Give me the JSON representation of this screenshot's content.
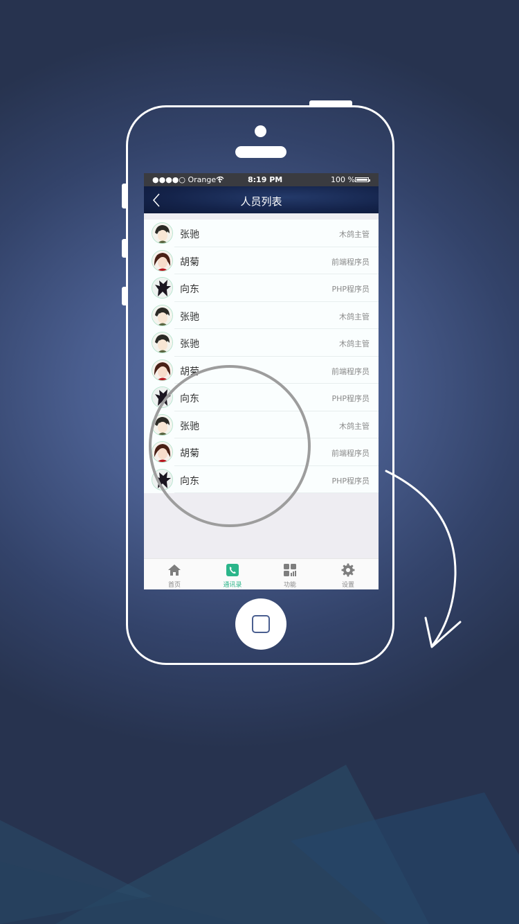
{
  "status_bar": {
    "carrier": "●●●●○ Orange F",
    "time": "8:19 PM",
    "battery": "100 %"
  },
  "nav": {
    "title": "人员列表",
    "back_icon": "chevron-left-icon"
  },
  "contacts": [
    {
      "name": "张驰",
      "role": "木鸽主管",
      "avatar": "boy"
    },
    {
      "name": "胡菊",
      "role": "前端程序员",
      "avatar": "girl"
    },
    {
      "name": "向东",
      "role": "PHP程序员",
      "avatar": "dark"
    },
    {
      "name": "张驰",
      "role": "木鸽主管",
      "avatar": "boy"
    },
    {
      "name": "张驰",
      "role": "木鸽主管",
      "avatar": "boy"
    },
    {
      "name": "胡菊",
      "role": "前端程序员",
      "avatar": "girl"
    },
    {
      "name": "向东",
      "role": "PHP程序员",
      "avatar": "dark"
    },
    {
      "name": "张驰",
      "role": "木鸽主管",
      "avatar": "boy"
    },
    {
      "name": "胡菊",
      "role": "前端程序员",
      "avatar": "girl"
    },
    {
      "name": "向东",
      "role": "PHP程序员",
      "avatar": "dark"
    }
  ],
  "tabs": [
    {
      "label": "首页",
      "icon": "home-icon",
      "active": false
    },
    {
      "label": "通讯录",
      "icon": "phone-icon",
      "active": true
    },
    {
      "label": "功能",
      "icon": "grid-icon",
      "active": false
    },
    {
      "label": "设置",
      "icon": "gear-icon",
      "active": false
    }
  ],
  "colors": {
    "accent": "#2bb58a",
    "navbar": "#14234a",
    "background": "#4a5e8f"
  }
}
